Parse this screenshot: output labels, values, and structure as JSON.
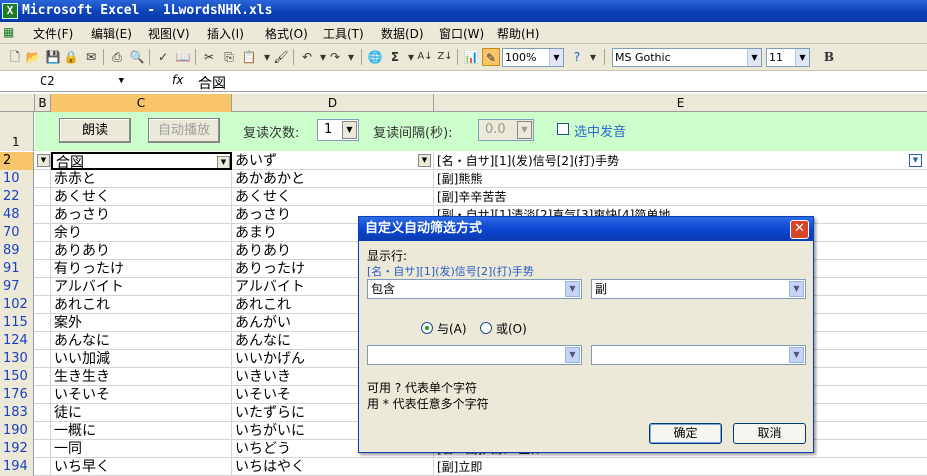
{
  "window": {
    "title": "Microsoft Excel - 1LwordsNHK.xls"
  },
  "menu": [
    "文件(F)",
    "编辑(E)",
    "视图(V)",
    "插入(I)",
    "格式(O)",
    "工具(T)",
    "数据(D)",
    "窗口(W)",
    "帮助(H)"
  ],
  "toolbar": {
    "zoom": "100%",
    "font_name": "MS Gothic",
    "font_size": "11",
    "bold_label": "B"
  },
  "formula_bar": {
    "name_box": "C2",
    "fx": "fx",
    "value": "合図"
  },
  "columns": {
    "b": "B",
    "c": "C",
    "d": "D",
    "e": "E"
  },
  "panel": {
    "row_num": "1",
    "read_btn": "朗读",
    "auto_btn": "自动播放",
    "repeat_label": "复读次数:",
    "repeat_value": "1",
    "interval_label": "复读间隔(秒):",
    "interval_value": "0.0",
    "checkbox_label": "选中发音"
  },
  "header_row": {
    "num": "2",
    "c": "合図",
    "d": "あいず",
    "e": "[名・自サ][1](发)信号[2](打)手势"
  },
  "rows": [
    {
      "num": "10",
      "c": "赤赤と",
      "d": "あかあかと",
      "e": "[副]熊熊"
    },
    {
      "num": "22",
      "c": "あくせく",
      "d": "あくせく",
      "e": "[副]辛辛苦苦"
    },
    {
      "num": "48",
      "c": "あっさり",
      "d": "あっさり",
      "e": "[副・自サ][1]清淡[2]直气[3]爽快[4]简单地"
    },
    {
      "num": "70",
      "c": "余り",
      "d": "あまり",
      "e": "[副]（后接否定）不太，不"
    },
    {
      "num": "89",
      "c": "ありあり",
      "d": "ありあり",
      "e": ""
    },
    {
      "num": "91",
      "c": "有りったけ",
      "d": "ありったけ",
      "e": ""
    },
    {
      "num": "97",
      "c": "アルバイト",
      "d": "アルバイト",
      "e": ""
    },
    {
      "num": "102",
      "c": "あれこれ",
      "d": "あれこれ",
      "e": ""
    },
    {
      "num": "115",
      "c": "案外",
      "d": "あんがい",
      "e": ""
    },
    {
      "num": "124",
      "c": "あんなに",
      "d": "あんなに",
      "e": ""
    },
    {
      "num": "130",
      "c": "いい加減",
      "d": "いいかげん",
      "e": ""
    },
    {
      "num": "150",
      "c": "生き生き",
      "d": "いきいき",
      "e": ""
    },
    {
      "num": "176",
      "c": "いそいそ",
      "d": "いそいそ",
      "e": ""
    },
    {
      "num": "183",
      "c": "徒に",
      "d": "いたずらに",
      "e": ""
    },
    {
      "num": "190",
      "c": "一概に",
      "d": "いちがいに",
      "e": ""
    },
    {
      "num": "192",
      "c": "一同",
      "d": "いちどう",
      "e": "[名・副]大家・全体"
    },
    {
      "num": "194",
      "c": "いち早く",
      "d": "いちはやく",
      "e": "[副]立即"
    }
  ],
  "dialog": {
    "title": "自定义自动筛选方式",
    "show_rows_label": "显示行:",
    "field_label": "[名・自サ][1](发)信号[2](打)手势",
    "op1": "包含",
    "val1": "副",
    "and_label": "与(A)",
    "or_label": "或(O)",
    "op2": "",
    "val2": "",
    "hint1": "可用 ? 代表单个字符",
    "hint2": "用 * 代表任意多个字符",
    "ok": "确定",
    "cancel": "取消"
  }
}
